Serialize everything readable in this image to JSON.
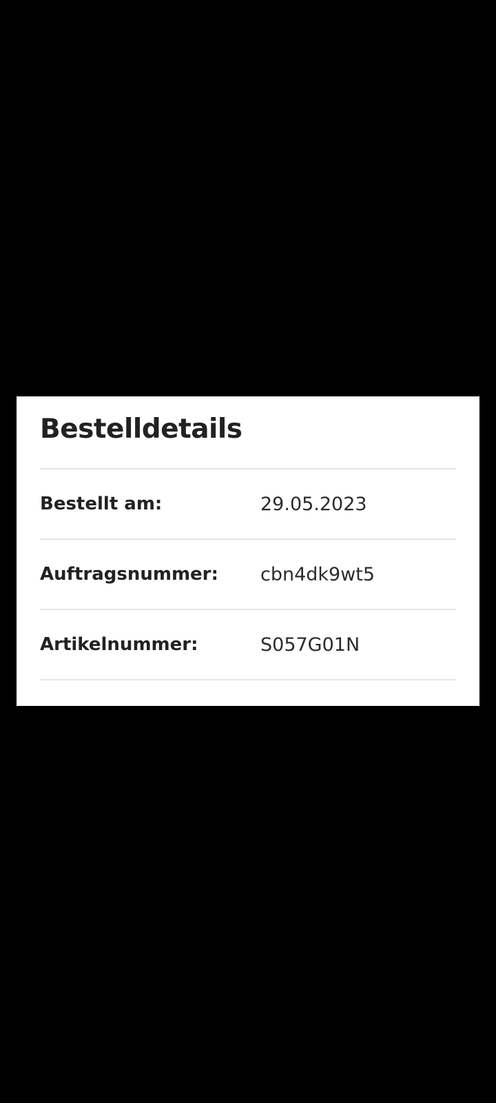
{
  "order_details": {
    "title": "Bestelldetails",
    "rows": [
      {
        "label": "Bestellt am:",
        "value": "29.05.2023"
      },
      {
        "label": "Auftragsnummer:",
        "value": "cbn4dk9wt5"
      },
      {
        "label": "Artikelnummer:",
        "value": "S057G01N"
      }
    ]
  }
}
